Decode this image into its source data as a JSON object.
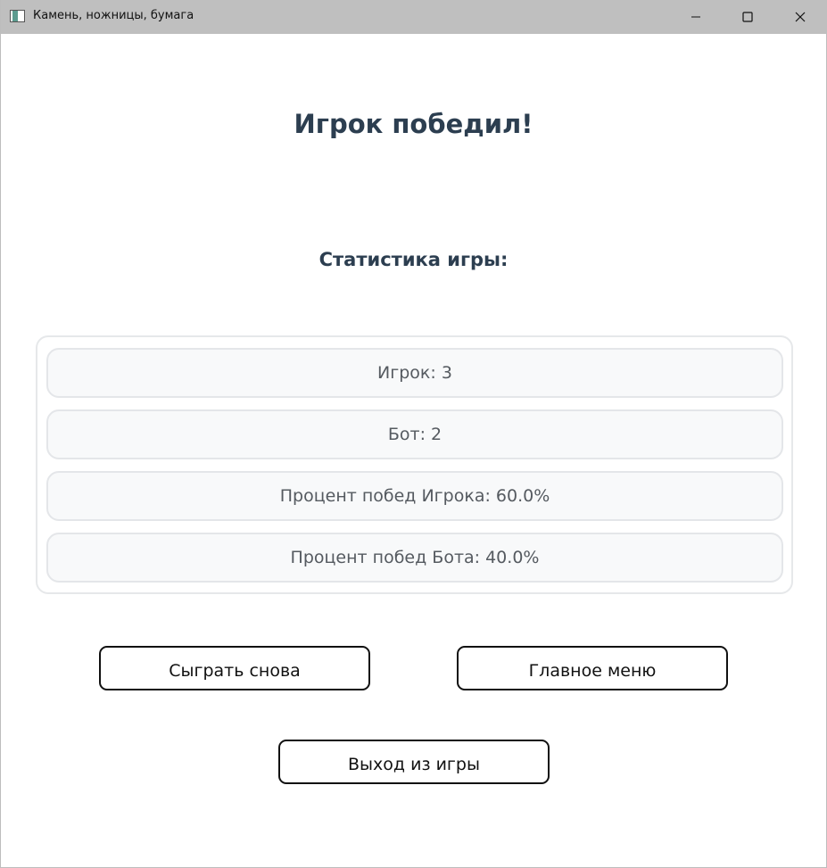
{
  "window": {
    "title": "Камень, ножницы, бумага",
    "icon": "app-icon",
    "controls": [
      "minimize-icon",
      "maximize-icon",
      "close-icon"
    ]
  },
  "result": {
    "title": "Игрок победил!"
  },
  "stats": {
    "title": "Статистика игры:",
    "rows": [
      "Игрок: 3",
      "Бот: 2",
      "Процент побед Игрока: 60.0%",
      "Процент побед Бота: 40.0%"
    ]
  },
  "buttons": {
    "play_again": "Сыграть снова",
    "main_menu": "Главное меню",
    "exit": "Выход из игры"
  },
  "colors": {
    "heading": "#2c3e50",
    "stat_text": "#555a60",
    "stat_background": "#f8f9fa",
    "titlebar": "#bfbfbf"
  }
}
